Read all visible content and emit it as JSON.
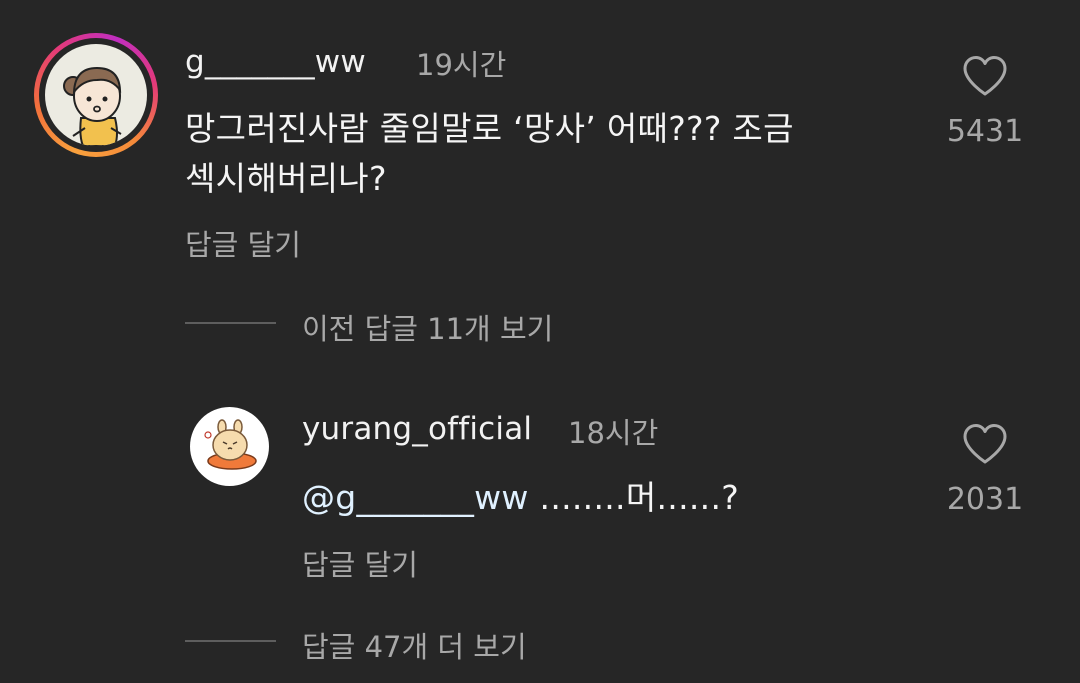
{
  "comment": {
    "username": "g_______ww",
    "time": "19시간",
    "text_line1": "망그러진사람 줄임말로 ‘망사’ 어때??? 조금",
    "text_line2": "섹시해버리나?",
    "reply_label": "답글 달기",
    "like_count": "5431"
  },
  "view_previous": {
    "label": "이전 답글 11개 보기"
  },
  "reply": {
    "username": "yurang_official",
    "time": "18시간",
    "mention": "@g_______ww",
    "text": " ........머......?",
    "reply_label": "답글 달기",
    "like_count": "2031"
  },
  "view_more": {
    "label": "답글 47개 더 보기"
  },
  "colors": {
    "background": "#262626",
    "text_primary": "#f2f2f2",
    "text_secondary": "#a8a8a8",
    "story_ring": "#e43a78"
  },
  "icons": {
    "like": "heart-outline-icon"
  }
}
